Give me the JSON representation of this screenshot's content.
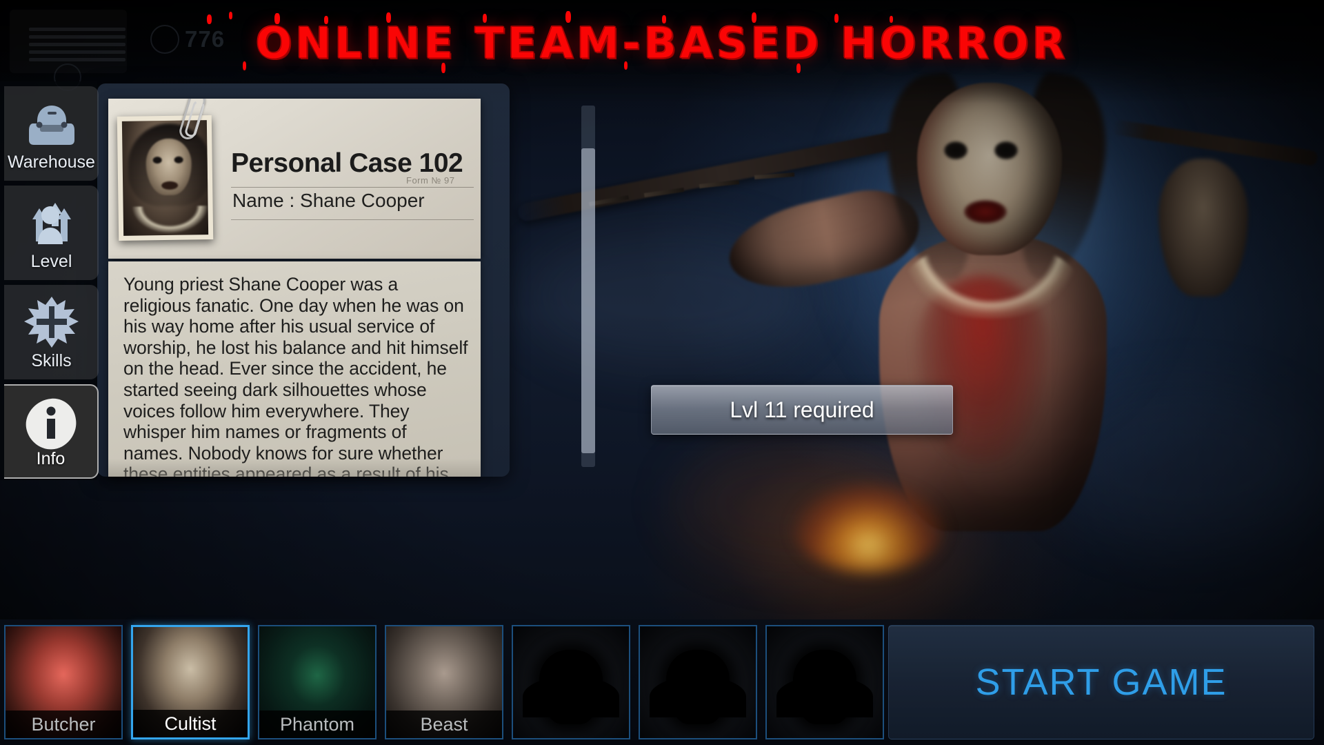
{
  "title": "ONLINE  TEAM-BASED  HORROR",
  "topbar": {
    "currency": "776"
  },
  "sidebar": {
    "items": [
      {
        "label": "Warehouse",
        "icon": "backpack-icon",
        "selected": false
      },
      {
        "label": "Level",
        "icon": "level-up-icon",
        "selected": false
      },
      {
        "label": "Skills",
        "icon": "skill-burst-icon",
        "selected": false
      },
      {
        "label": "Info",
        "icon": "info-icon",
        "selected": true
      }
    ]
  },
  "case_file": {
    "heading": "Personal Case 102",
    "form_number": "Form № 97",
    "name_label": "Name : Shane Cooper",
    "body": "Young priest Shane Cooper was a religious fanatic. One day when he was on his way home after his usual service of worship, he lost his balance and hit himself on the head. Ever since the accident, he started seeing dark silhouettes whose voices follow him everywhere. They whisper him names or fragments of names. Nobody knows for sure whether these entities appeared as a result of his head injury or if they are some kind of demonic force that possessed his consciousness. In the end, the “dark"
  },
  "level_banner": {
    "text": "Lvl 11 required"
  },
  "characters": [
    {
      "name": "Butcher",
      "art": "art-butcher",
      "selected": false,
      "locked": false
    },
    {
      "name": "Cultist",
      "art": "art-cultist",
      "selected": true,
      "locked": false
    },
    {
      "name": "Phantom",
      "art": "art-phantom",
      "selected": false,
      "locked": false
    },
    {
      "name": "Beast",
      "art": "art-beast",
      "selected": false,
      "locked": false
    },
    {
      "name": "",
      "art": "art-locked",
      "selected": false,
      "locked": true
    },
    {
      "name": "",
      "art": "art-locked",
      "selected": false,
      "locked": true
    },
    {
      "name": "",
      "art": "art-locked",
      "selected": false,
      "locked": true
    }
  ],
  "start_button": {
    "label": "START GAME"
  },
  "colors": {
    "title_red": "#fa0505",
    "accent_blue": "#2f9ee8",
    "selected_border": "#34a6ee",
    "card_border": "#1c4f7d",
    "paper": "#d8d4c9"
  }
}
